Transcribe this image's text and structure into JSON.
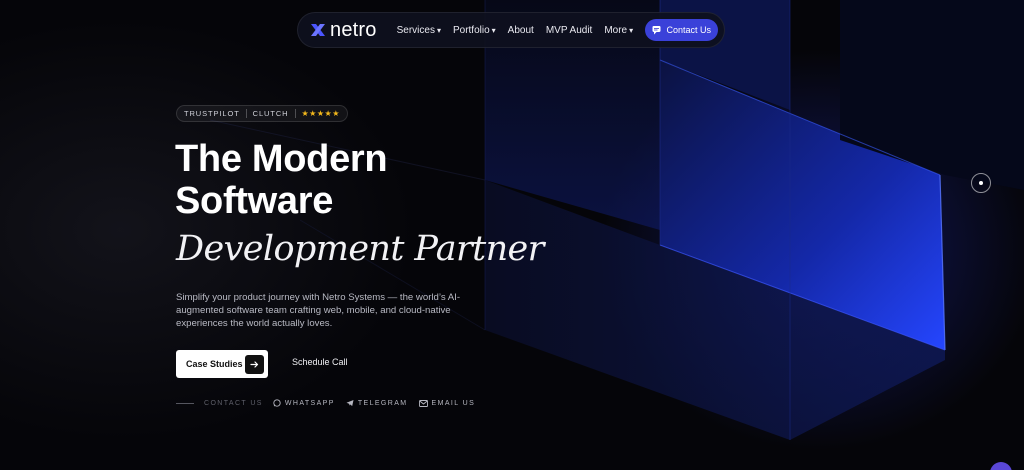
{
  "nav": {
    "logo_text": "netro",
    "links": [
      {
        "label": "Services",
        "has_menu": true
      },
      {
        "label": "Portfolio",
        "has_menu": true
      },
      {
        "label": "About",
        "has_menu": false
      },
      {
        "label": "MVP Audit",
        "has_menu": false
      },
      {
        "label": "More",
        "has_menu": true
      }
    ],
    "contact_label": "Contact Us"
  },
  "badge": {
    "items": [
      "TRUSTPILOT",
      "CLUTCH"
    ],
    "stars": "★★★★★"
  },
  "hero": {
    "title_line1": "The Modern",
    "title_line2": "Software",
    "title_line3": "Development Partner",
    "description": "Simplify your product journey with Netro Systems — the world’s AI-augmented software team crafting web, mobile, and cloud-native experiences the world actually loves.",
    "primary_cta": "Case Studies",
    "secondary_cta": "Schedule Call"
  },
  "contact": {
    "label": "CONTACT US",
    "links": [
      {
        "label": "WHATSAPP",
        "icon": "whatsapp-icon"
      },
      {
        "label": "TELEGRAM",
        "icon": "telegram-icon"
      },
      {
        "label": "EMAIL US",
        "icon": "mail-icon"
      }
    ]
  },
  "colors": {
    "accent": "#3a41d9",
    "background": "#050509",
    "star": "#f5b91c",
    "panel_blue": "#1b38d8"
  }
}
